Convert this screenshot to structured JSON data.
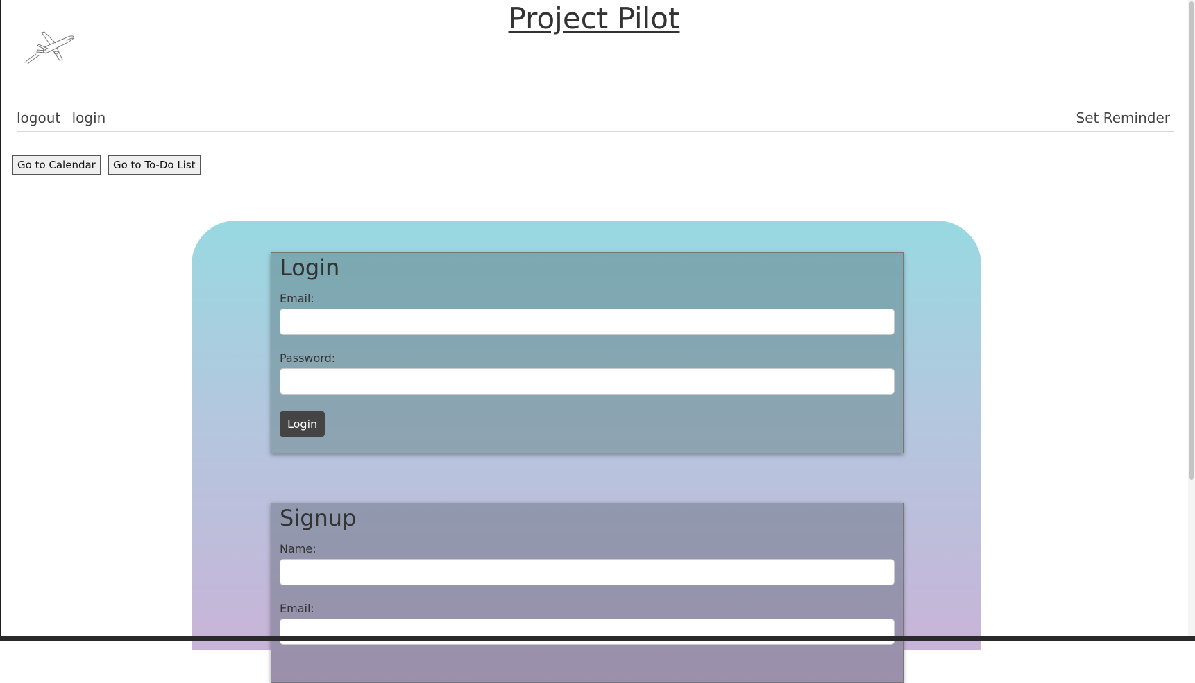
{
  "header": {
    "title": "Project Pilot",
    "logo_icon": "airplane-sketch-icon"
  },
  "nav": {
    "logout": "logout",
    "login": "login",
    "set_reminder": "Set Reminder"
  },
  "actions": {
    "calendar": "Go to Calendar",
    "todo": "Go to To-Do List"
  },
  "login_form": {
    "heading": "Login",
    "email_label": "Email:",
    "email_value": "",
    "password_label": "Password:",
    "password_value": "",
    "submit": "Login"
  },
  "signup_form": {
    "heading": "Signup",
    "name_label": "Name:",
    "name_value": "",
    "email_label": "Email:",
    "email_value": ""
  },
  "colors": {
    "gradient_top": "#98d9e1",
    "gradient_bottom": "#c8b4d8",
    "login_button": "#444444"
  }
}
